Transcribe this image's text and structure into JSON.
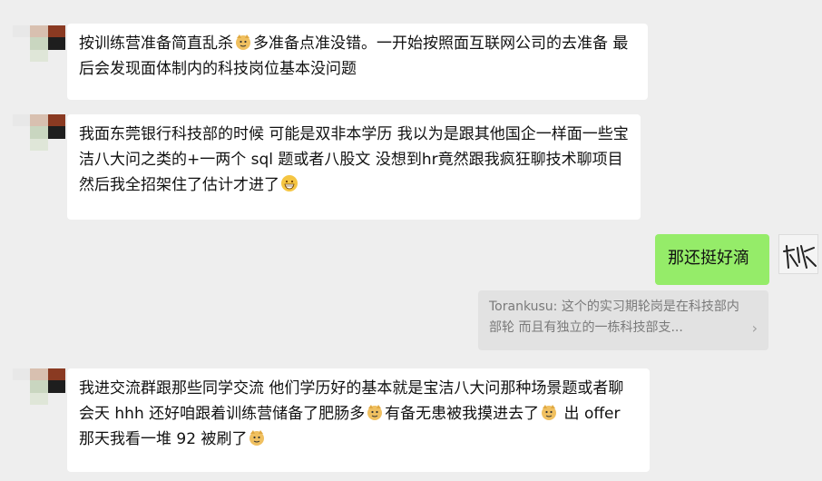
{
  "messages": [
    {
      "sender": "other",
      "parts": [
        "按训练营准备简直乱杀",
        "多准备点准没错。一开始按照面互联网公司的去准备 最后会发现面体制内的科技岗位基本没问题"
      ]
    },
    {
      "sender": "other",
      "parts": [
        "我面东莞银行科技部的时候 可能是双非本学历 我以为是跟其他国企一样面一些宝洁八大问之类的+一两个 sql 题或者八股文 没想到hr竟然跟我疯狂聊技术聊项目 然后我全招架住了估计才进了"
      ]
    },
    {
      "sender": "me",
      "text": "那还挺好滴"
    },
    {
      "sender": "quote",
      "text": "Torankusu: 这个的实习期轮岗是在科技部内部轮 而且有独立的一栋科技部支..."
    },
    {
      "sender": "other",
      "parts": [
        "我进交流群跟那些同学交流 他们学历好的基本就是宝洁八大问那种场景题或者聊会天 hhh  还好咱跟着训练营储备了肥肠多",
        "有备无患被我摸进去了",
        " 出 offer 那天我看一堆 92 被刷了"
      ]
    }
  ],
  "colors": {
    "background": "#eeeeee",
    "bubble_other": "#ffffff",
    "bubble_me": "#95ec69",
    "quote_bg": "#e2e2e2"
  },
  "icons": [
    "doge-emoji",
    "grin-emoji",
    "chevron-right-icon"
  ]
}
